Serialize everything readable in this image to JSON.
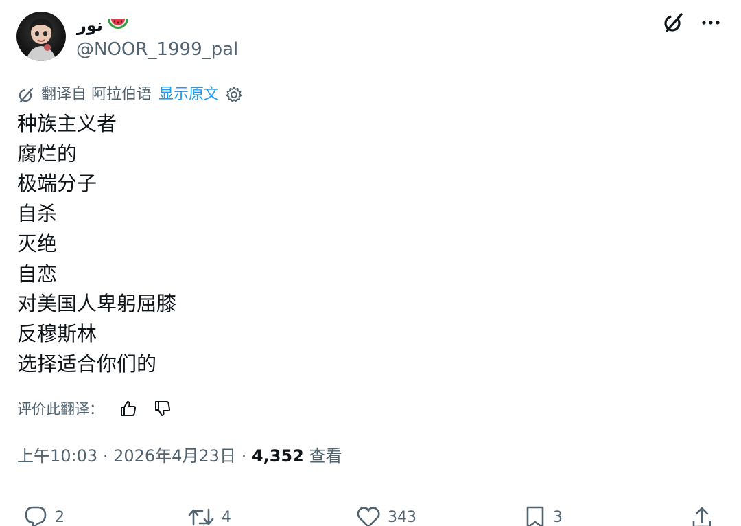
{
  "author": {
    "display_name": "نور",
    "handle": "@NOOR_1999_pal",
    "avatar_icon": "avatar-photo",
    "name_emoji_icon": "watermelon-icon"
  },
  "header": {
    "grok_icon": "grok-icon",
    "more_icon": "more-dots-icon"
  },
  "translation": {
    "translated_from": "翻译自 阿拉伯语",
    "show_original": "显示原文",
    "settings_icon": "gear-icon"
  },
  "tweet": {
    "lines": [
      "种族主义者",
      "腐烂的",
      "极端分子",
      "自杀",
      "灭绝",
      "自恋",
      "对美国人卑躬屈膝",
      "反穆斯林",
      "选择适合你们的"
    ]
  },
  "rate_translation": {
    "label": "评价此翻译："
  },
  "meta": {
    "time": "上午10:03",
    "separator": "·",
    "date": "2026年4月23日",
    "views": "4,352",
    "views_label": "查看"
  },
  "actions": {
    "replies": "2",
    "reposts": "4",
    "likes": "343",
    "bookmarks": "3"
  },
  "colors": {
    "text": "#0f1419",
    "secondary": "#536471",
    "link": "#1d9bf0"
  }
}
